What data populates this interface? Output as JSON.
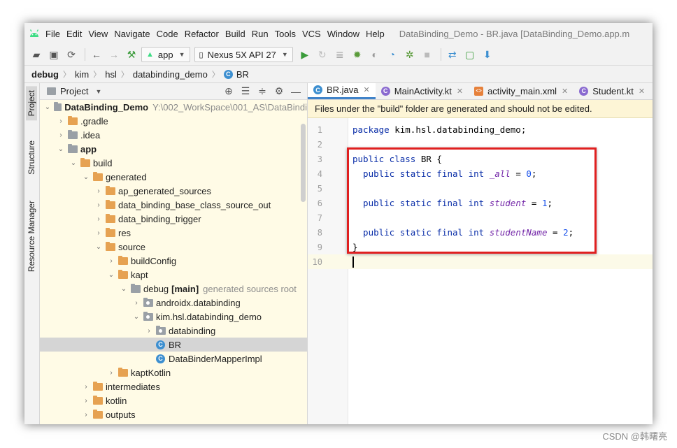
{
  "menubar": {
    "items": [
      "File",
      "Edit",
      "View",
      "Navigate",
      "Code",
      "Refactor",
      "Build",
      "Run",
      "Tools",
      "VCS",
      "Window",
      "Help"
    ],
    "title": "DataBinding_Demo - BR.java [DataBinding_Demo.app.m"
  },
  "toolbar": {
    "config_label": "app",
    "device_label": "Nexus 5X API 27"
  },
  "breadcrumb": [
    "debug",
    "kim",
    "hsl",
    "databinding_demo",
    "BR"
  ],
  "sidestrip": {
    "tabs": [
      "Project",
      "Structure",
      "Resource Manager"
    ]
  },
  "project": {
    "header": "Project",
    "nodes": [
      {
        "label": "DataBinding_Demo",
        "extra": "Y:\\002_WorkSpace\\001_AS\\DataBindi",
        "icon": "folder-gray-icon",
        "expanded": true,
        "bold": true
      },
      {
        "label": ".gradle",
        "icon": "folder-icon",
        "expanded": false
      },
      {
        "label": ".idea",
        "icon": "folder-gray-icon",
        "expanded": false
      },
      {
        "label": "app",
        "icon": "module-folder-icon",
        "expanded": true,
        "bold": true
      },
      {
        "label": "build",
        "icon": "folder-icon",
        "expanded": true
      },
      {
        "label": "generated",
        "icon": "folder-icon",
        "expanded": true
      },
      {
        "label": "ap_generated_sources",
        "icon": "folder-icon",
        "expanded": false
      },
      {
        "label": "data_binding_base_class_source_out",
        "icon": "folder-icon",
        "expanded": false
      },
      {
        "label": "data_binding_trigger",
        "icon": "folder-icon",
        "expanded": false
      },
      {
        "label": "res",
        "icon": "folder-icon",
        "expanded": false
      },
      {
        "label": "source",
        "icon": "folder-icon",
        "expanded": true
      },
      {
        "label": "buildConfig",
        "icon": "folder-icon",
        "expanded": false
      },
      {
        "label": "kapt",
        "icon": "folder-icon",
        "expanded": true
      },
      {
        "label": "debug",
        "badge": "[main]",
        "extra": "generated sources root",
        "icon": "folder-gray-icon",
        "expanded": true
      },
      {
        "label": "androidx.databinding",
        "icon": "package-icon",
        "expanded": false
      },
      {
        "label": "kim.hsl.databinding_demo",
        "icon": "package-icon",
        "expanded": true
      },
      {
        "label": "databinding",
        "icon": "package-icon",
        "expanded": false
      },
      {
        "label": "BR",
        "icon": "class-icon",
        "selected": true
      },
      {
        "label": "DataBinderMapperImpl",
        "icon": "class-icon"
      },
      {
        "label": "kaptKotlin",
        "icon": "folder-icon",
        "expanded": false
      },
      {
        "label": "intermediates",
        "icon": "folder-icon",
        "expanded": false
      },
      {
        "label": "kotlin",
        "icon": "folder-icon",
        "expanded": false
      },
      {
        "label": "outputs",
        "icon": "folder-icon",
        "expanded": false
      }
    ]
  },
  "editor": {
    "tabs": [
      {
        "label": "BR.java",
        "icon": "java-class-icon",
        "active": true
      },
      {
        "label": "MainActivity.kt",
        "icon": "kotlin-file-icon"
      },
      {
        "label": "activity_main.xml",
        "icon": "xml-file-icon"
      },
      {
        "label": "Student.kt",
        "icon": "kotlin-file-icon"
      }
    ],
    "notice": "Files under the \"build\" folder are generated and should not be edited.",
    "lines": [
      {
        "num": "1",
        "tokens": [
          {
            "t": "package",
            "c": "kw"
          },
          {
            "t": " kim.hsl.databinding_demo;",
            "c": ""
          }
        ]
      },
      {
        "num": "2",
        "tokens": []
      },
      {
        "num": "3",
        "tokens": [
          {
            "t": "public class",
            "c": "kw"
          },
          {
            "t": " BR {",
            "c": ""
          }
        ]
      },
      {
        "num": "4",
        "tokens": [
          {
            "t": "  public static final int",
            "c": "kw"
          },
          {
            "t": " ",
            "c": ""
          },
          {
            "t": "_all",
            "c": "fld"
          },
          {
            "t": " = ",
            "c": ""
          },
          {
            "t": "0",
            "c": "num"
          },
          {
            "t": ";",
            "c": ""
          }
        ]
      },
      {
        "num": "5",
        "tokens": []
      },
      {
        "num": "6",
        "tokens": [
          {
            "t": "  public static final int",
            "c": "kw"
          },
          {
            "t": " ",
            "c": ""
          },
          {
            "t": "student",
            "c": "fld"
          },
          {
            "t": " = ",
            "c": ""
          },
          {
            "t": "1",
            "c": "num"
          },
          {
            "t": ";",
            "c": ""
          }
        ]
      },
      {
        "num": "7",
        "tokens": []
      },
      {
        "num": "8",
        "tokens": [
          {
            "t": "  public static final int",
            "c": "kw"
          },
          {
            "t": " ",
            "c": ""
          },
          {
            "t": "studentName",
            "c": "fld"
          },
          {
            "t": " = ",
            "c": ""
          },
          {
            "t": "2",
            "c": "num"
          },
          {
            "t": ";",
            "c": ""
          }
        ]
      },
      {
        "num": "9",
        "tokens": [
          {
            "t": "}",
            "c": ""
          }
        ]
      },
      {
        "num": "10",
        "tokens": [],
        "current": true
      }
    ]
  },
  "watermark": "CSDN @韩曙亮",
  "colors": {
    "accent": "#4083c9",
    "highlight_box": "#e02020",
    "keyword": "#0a2ea8",
    "field": "#7326a8",
    "number": "#1750eb",
    "project_bg": "#fffbe6"
  }
}
